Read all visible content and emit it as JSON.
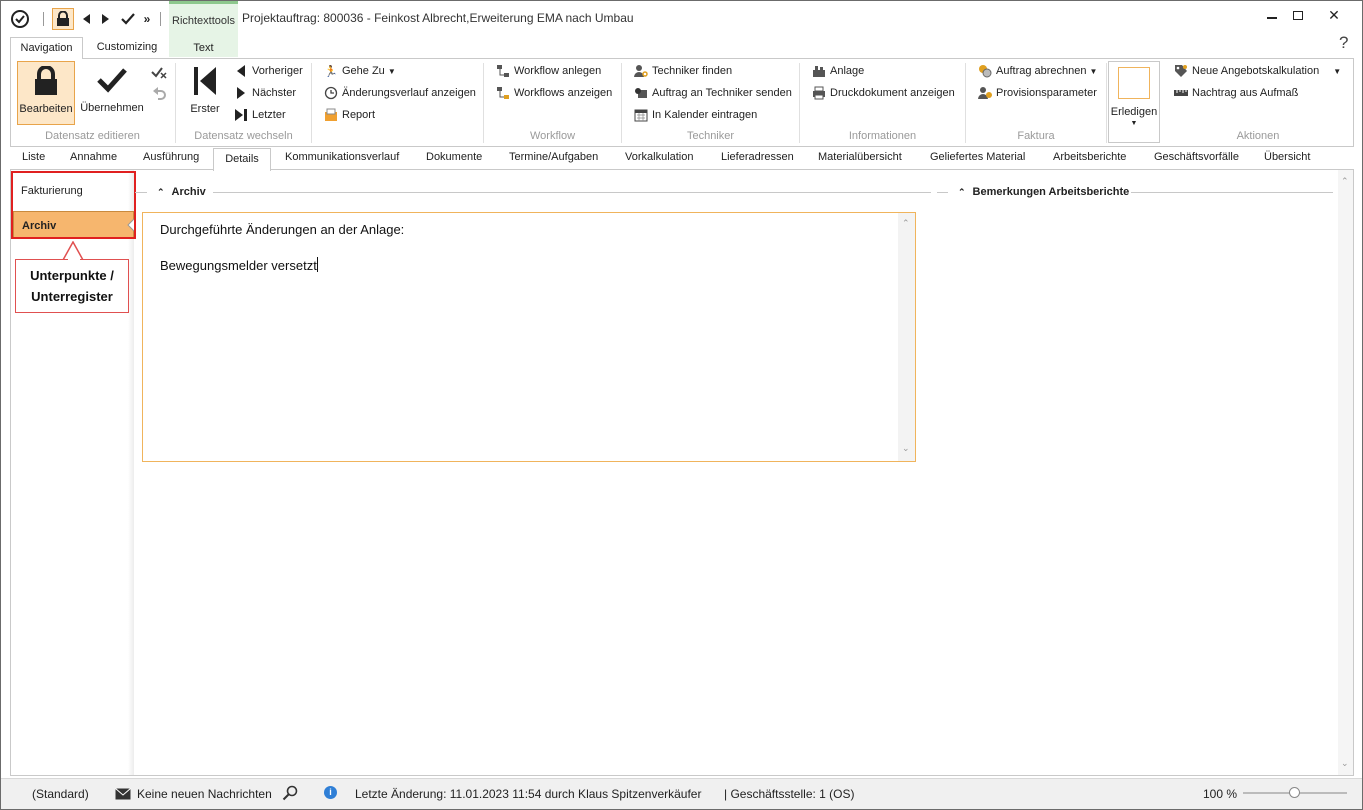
{
  "window": {
    "title": "Projektauftrag: 800036 - Feinkost Albrecht,Erweiterung EMA nach Umbau",
    "context_group": "Richtexttools",
    "minimize": "—",
    "maximize": "☐",
    "close": "✕"
  },
  "ribbon_tabs": [
    "Navigation",
    "Customizing",
    "Text"
  ],
  "help": "?",
  "ribbon": {
    "datensatz_editieren": {
      "label": "Datensatz editieren",
      "bearbeiten": "Bearbeiten",
      "uebernehmen": "Übernehmen"
    },
    "datensatz_wechseln": {
      "label": "Datensatz wechseln",
      "erster": "Erster",
      "vorheriger": "Vorheriger",
      "naechster": "Nächster",
      "letzter": "Letzter"
    },
    "misc": {
      "gehe_zu": "Gehe Zu",
      "aenderungsverlauf": "Änderungsverlauf anzeigen",
      "report": "Report"
    },
    "workflow": {
      "label": "Workflow",
      "anlegen": "Workflow anlegen",
      "anzeigen": "Workflows anzeigen"
    },
    "techniker": {
      "label": "Techniker",
      "finden": "Techniker finden",
      "senden": "Auftrag an Techniker senden",
      "kalender": "In Kalender eintragen"
    },
    "informationen": {
      "label": "Informationen",
      "anlage": "Anlage",
      "druckdokument": "Druckdokument anzeigen"
    },
    "faktura": {
      "label": "Faktura",
      "abrechnen": "Auftrag abrechnen",
      "provision": "Provisionsparameter"
    },
    "erledigen": "Erledigen",
    "aktionen": {
      "label": "Aktionen",
      "angebot": "Neue Angebotskalkulation",
      "nachtrag": "Nachtrag aus Aufmaß"
    }
  },
  "detail_tabs": [
    "Liste",
    "Annahme",
    "Ausführung",
    "Details",
    "Kommunikationsverlauf",
    "Dokumente",
    "Termine/Aufgaben",
    "Vorkalkulation",
    "Lieferadressen",
    "Materialübersicht",
    "Geliefertes Material",
    "Arbeitsberichte",
    "Geschäftsvorfälle",
    "Übersicht"
  ],
  "subnav": {
    "items": [
      "Fakturierung",
      "Archiv"
    ],
    "selected": "Archiv"
  },
  "callout": {
    "line1": "Unterpunkte /",
    "line2": "Unterregister"
  },
  "sections": {
    "archiv": {
      "title": "Archiv",
      "text_line1": "Durchgeführte Änderungen an der Anlage:",
      "text_line2": "Bewegungsmelder versetzt"
    },
    "bemerkungen": {
      "title": "Bemerkungen Arbeitsberichte"
    }
  },
  "statusbar": {
    "profile": "(Standard)",
    "messages": "Keine neuen Nachrichten",
    "last_change": "Letzte Änderung: 11.01.2023 11:54 durch Klaus Spitzenverkäufer",
    "branch": "| Geschäftsstelle:  1 (OS)",
    "zoom": "100 %",
    "zoom_level": 0.5
  },
  "colors": {
    "accent": "#f6b66e",
    "context_green": "#e6f4e6",
    "callout_red": "#e02020",
    "info_blue": "#2f7fd6"
  }
}
